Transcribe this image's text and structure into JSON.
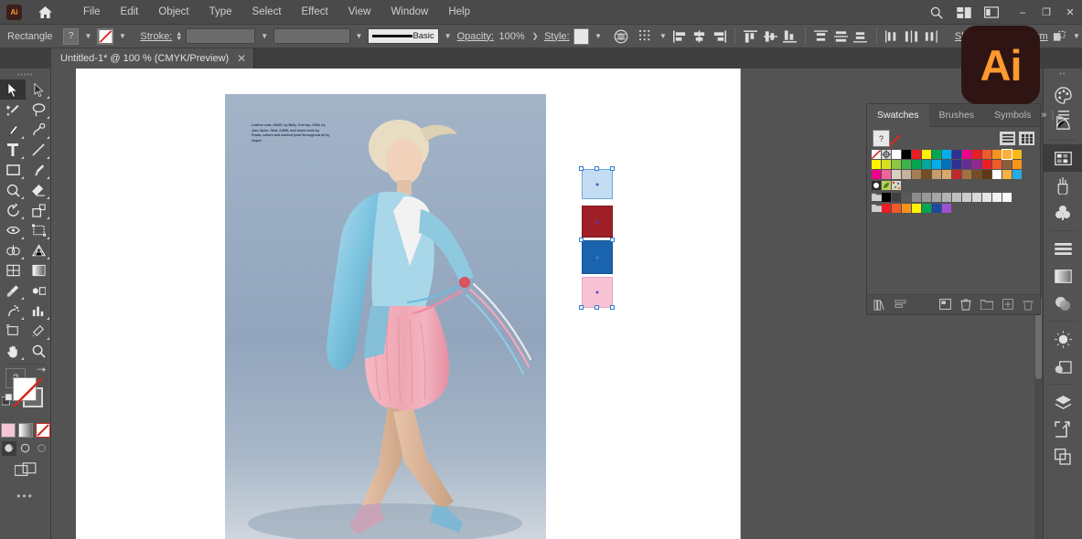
{
  "app": {
    "name": "Adobe Illustrator",
    "logo_text": "Ai",
    "accent_color": "#ff9a2e",
    "logo_bg": "#2e1513"
  },
  "menubar": {
    "items": [
      "File",
      "Edit",
      "Object",
      "Type",
      "Select",
      "Effect",
      "View",
      "Window",
      "Help"
    ],
    "icons": {
      "app_badge": "ai-logo-icon",
      "home": "home-icon",
      "search": "search-icon",
      "arrange_documents": "arrange-documents-icon",
      "workspace_switcher": "workspace-switcher-icon",
      "minimize": "minimize-icon",
      "restore": "restore-icon",
      "close": "close-icon"
    },
    "window_buttons": [
      "–",
      "❐",
      "✕"
    ]
  },
  "controlbar": {
    "object_label": "Rectangle",
    "fill_value": "?",
    "stroke_label": "Stroke:",
    "stroke_weight": "",
    "stroke_profile": "",
    "brush_label": "Basic",
    "opacity_label": "Opacity:",
    "opacity_value": "100%",
    "style_label": "Style:",
    "shape_label": "Shape:",
    "transform_label": "Transform",
    "icons": {
      "fill_swatch": "fill-swatch-icon",
      "stroke_swatch": "stroke-swatch-icon",
      "stroke_stepper": "stepper-icon",
      "recolor_artwork": "recolor-artwork-icon",
      "align_options": "align-options-icon",
      "align_left": "align-left-icon",
      "align_center_h": "align-center-horizontal-icon",
      "align_right": "align-right-icon",
      "align_top": "align-top-icon",
      "align_middle_v": "align-middle-vertical-icon",
      "align_bottom": "align-bottom-icon",
      "distribute_top": "distribute-top-icon",
      "distribute_center_v": "distribute-center-vertical-icon",
      "distribute_bottom": "distribute-bottom-icon",
      "distribute_left": "distribute-left-icon",
      "distribute_center_h": "distribute-center-horizontal-icon",
      "distribute_right": "distribute-right-icon",
      "transform_ref": "transform-reference-icon"
    }
  },
  "document_tab": {
    "title": "Untitled-1* @ 100 % (CMYK/Preview)",
    "close": "✕"
  },
  "toolbar": {
    "grip": "•••••",
    "tools": [
      {
        "name": "selection-tool",
        "active": true
      },
      {
        "name": "direct-selection-tool",
        "active": false
      },
      {
        "name": "magic-wand-tool",
        "active": false
      },
      {
        "name": "lasso-tool",
        "active": false
      },
      {
        "name": "pen-tool",
        "active": false
      },
      {
        "name": "curvature-tool",
        "active": false
      },
      {
        "name": "type-tool",
        "active": false
      },
      {
        "name": "line-segment-tool",
        "active": false
      },
      {
        "name": "rectangle-tool",
        "active": false
      },
      {
        "name": "paintbrush-tool",
        "active": false
      },
      {
        "name": "shaper-tool",
        "active": false
      },
      {
        "name": "eraser-tool",
        "active": false
      },
      {
        "name": "rotate-tool",
        "active": false
      },
      {
        "name": "scale-tool",
        "active": false
      },
      {
        "name": "width-tool",
        "active": false
      },
      {
        "name": "free-transform-tool",
        "active": false
      },
      {
        "name": "shape-builder-tool",
        "active": false
      },
      {
        "name": "perspective-grid-tool",
        "active": false
      },
      {
        "name": "mesh-tool",
        "active": false
      },
      {
        "name": "gradient-tool",
        "active": false
      },
      {
        "name": "eyedropper-tool",
        "active": false
      },
      {
        "name": "blend-tool",
        "active": false
      },
      {
        "name": "symbol-sprayer-tool",
        "active": false
      },
      {
        "name": "column-graph-tool",
        "active": false
      },
      {
        "name": "artboard-tool",
        "active": false
      },
      {
        "name": "slice-tool",
        "active": false
      },
      {
        "name": "hand-tool",
        "active": false
      },
      {
        "name": "zoom-tool",
        "active": false
      }
    ],
    "color_controls": {
      "fill_question": "?",
      "swap_fill_stroke": "swap-fill-stroke-icon",
      "default_fill_stroke": "default-fill-stroke-icon",
      "fill_color": "#ffffff",
      "stroke_color": "none"
    },
    "mode_buttons": [
      "color-mode-icon",
      "gradient-mode-icon",
      "none-mode-icon"
    ],
    "draw_modes": [
      "draw-normal-icon",
      "draw-behind-icon",
      "draw-inside-icon"
    ],
    "screen_mode": "change-screen-mode-icon",
    "more_tools": "•••"
  },
  "canvas": {
    "photo_caption": "Leather coat, £6000, by Bally. Knit top, £398, by Jara Jacks. Skirt, £1850, and shoes both by Prada, collars and washed jewel throughout all by Vogue.",
    "selection": {
      "label": "selected-rectangles",
      "rects": [
        {
          "name": "swatch-rect-light-blue",
          "color": "#c3dcf2",
          "stroke": "#5aa0d8"
        },
        {
          "name": "swatch-rect-dark-red",
          "color": "#9e1f28",
          "stroke": "#7d1a21"
        },
        {
          "name": "swatch-rect-blue",
          "color": "#1a63ad",
          "stroke": "#17558f"
        },
        {
          "name": "swatch-rect-pink",
          "color": "#f7c3d4",
          "stroke": "#e8a6bd"
        }
      ]
    }
  },
  "swatches_panel": {
    "tabs": [
      {
        "label": "Swatches",
        "active": true
      },
      {
        "label": "Brushes",
        "active": false
      },
      {
        "label": "Symbols",
        "active": false
      }
    ],
    "collapse_icon": "»",
    "menu_icon": "panel-menu-icon",
    "none_swatch": "?",
    "view_list_icon": "list-view-icon",
    "view_grid_icon": "grid-view-icon",
    "footer_icons": [
      "swatch-libraries-icon",
      "show-swatch-kinds-icon",
      "swatch-options-icon",
      "new-color-group-icon",
      "new-swatch-icon",
      "delete-swatch-icon"
    ],
    "rows": [
      [
        "none",
        "registration",
        "#ffffff",
        "#000000",
        "#ed1c24",
        "#fff200",
        "#00a651",
        "#00aeef",
        "#2e3192",
        "#ec008c",
        "#ed1c24",
        "#f15a29",
        "#f7941e",
        "#fbb040",
        "#fdb913"
      ],
      [
        "#fff200",
        "#d7df23",
        "#8dc63f",
        "#39b54a",
        "#00a651",
        "#00a79d",
        "#00aeef",
        "#0072bc",
        "#2e3192",
        "#662d91",
        "#92278f",
        "#ed1c24",
        "#f15a29",
        "#8b5e3c",
        "#f7941e"
      ],
      [
        "#ec008c",
        "#f0629a",
        "#d9cfc2",
        "#c7b299",
        "#a67c52",
        "#754c24",
        "#c69c6d",
        "#d9a76c",
        "#c1272d",
        "#a3713f",
        "#754c24",
        "#603813",
        "#ffffff",
        "#fbb040",
        "#29abe2"
      ],
      [
        "pattern-dot",
        "pattern-leaf",
        "pattern-confetti"
      ],
      [
        "folder",
        "#000000",
        "#404040",
        "#595959",
        "#8c8c8c",
        "#999999",
        "#a6a6a6",
        "#b3b3b3",
        "#bfbfbf",
        "#cccccc",
        "#d9d9d9",
        "#e6e6e6",
        "#f2f2f2",
        "#fafafa"
      ],
      [
        "folder",
        "#ed1c24",
        "#f15a29",
        "#f7941e",
        "#fff200",
        "#00a651",
        "#1b4aa0",
        "#9e4fd0"
      ]
    ]
  },
  "right_dock": {
    "groups": [
      [
        "color-panel-icon",
        "color-guide-icon"
      ],
      [
        "swatches-panel-icon",
        "brushes-panel-icon",
        "symbols-panel-icon"
      ],
      [
        "align-panel-icon",
        "gradient-panel-icon",
        "transparency-panel-icon"
      ],
      [
        "appearance-panel-icon",
        "graphic-styles-panel-icon"
      ],
      [
        "layers-panel-icon",
        "artboards-panel-icon",
        "asset-export-panel-icon"
      ]
    ],
    "grip": "••"
  }
}
